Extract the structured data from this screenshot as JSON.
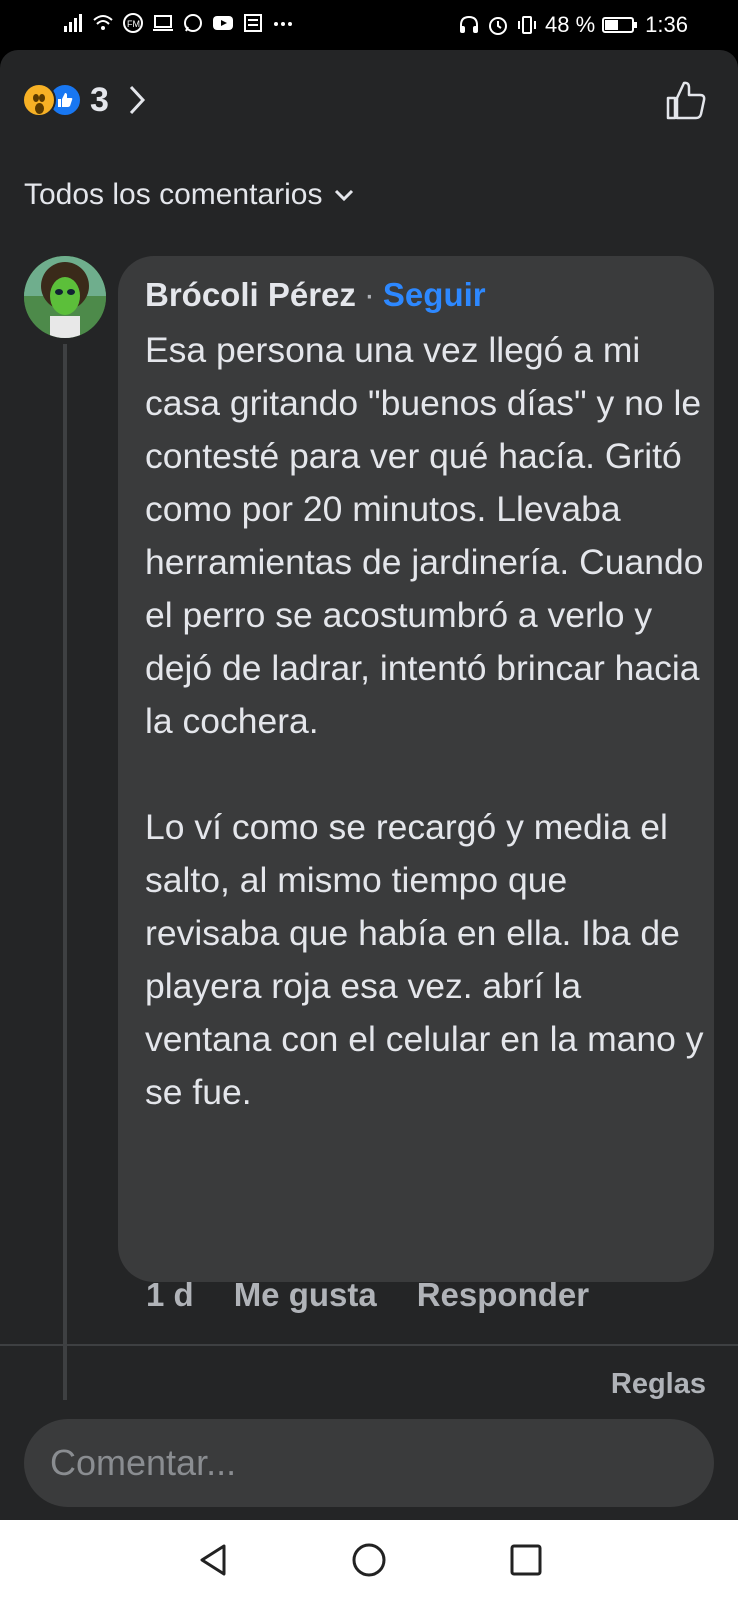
{
  "status_bar": {
    "battery_percent": "48 %",
    "time": "1:36",
    "left_icons": [
      "signal-icon",
      "wifi-icon",
      "fm-radio-icon",
      "laptop-icon",
      "whatsapp-icon",
      "youtube-icon",
      "news-icon",
      "more-icon"
    ],
    "right_icons": [
      "headset-icon",
      "alarm-icon",
      "vibrate-icon",
      "battery-icon"
    ]
  },
  "reactions": {
    "count": "3",
    "types": [
      "wow",
      "like"
    ]
  },
  "comments_filter": {
    "label": "Todos los comentarios"
  },
  "comment": {
    "author": "Brócoli Pérez",
    "separator": "·",
    "follow_label": "Seguir",
    "text": "Esa persona una vez llegó a mi casa gritando \"buenos días\" y no le contesté para ver qué hacía. Gritó como por 20 minutos. Llevaba herramientas de jardinería. Cuando el perro se acostumbró a verlo y dejó de ladrar, intentó brincar hacia la cochera.\n\nLo ví como se recargó y media el salto, al mismo tiempo que revisaba que había en ella. Iba de playera roja esa vez. abrí la ventana con el celular en la mano y se fue.",
    "time": "1 d",
    "like_label": "Me gusta",
    "reply_label": "Responder"
  },
  "footer": {
    "rules_label": "Reglas",
    "composer_placeholder": "Comentar..."
  },
  "colors": {
    "sheet_bg": "#242526",
    "bubble_bg": "#3a3b3c",
    "text_primary": "#e4e6eb",
    "text_secondary": "#b0b3b8",
    "link_blue": "#2d88ff"
  }
}
